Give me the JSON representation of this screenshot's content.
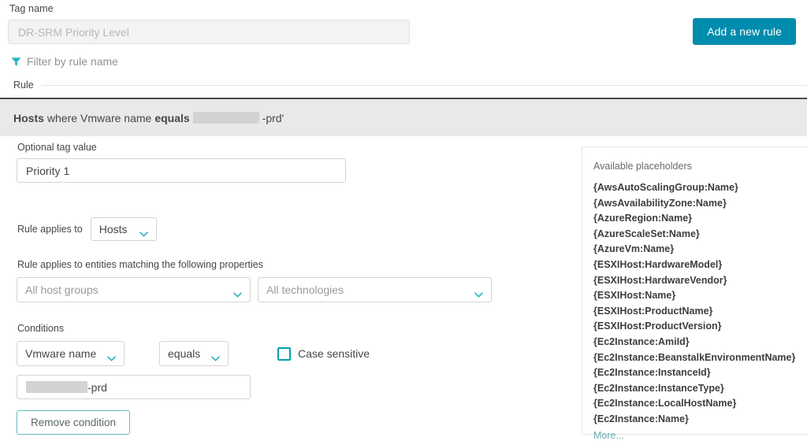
{
  "tag": {
    "label": "Tag name",
    "value_placeholder": "DR-SRM Priority Level"
  },
  "toolbar": {
    "add_rule_label": "Add a new rule"
  },
  "filter": {
    "placeholder": "Filter by rule name",
    "icon": "funnel-icon"
  },
  "rule_list": {
    "column_label": "Rule",
    "summary": {
      "entity": "Hosts",
      "where": "where",
      "attribute": "Vmware name",
      "operator": "equals",
      "redacted_value": "",
      "value_suffix": "-prd'"
    }
  },
  "form": {
    "optional_tag_value_label": "Optional tag value",
    "optional_tag_value": "Priority 1",
    "rule_applies_to_label": "Rule applies to",
    "rule_applies_to_value": "Hosts",
    "properties_label": "Rule applies to entities matching the following properties",
    "host_groups_value": "All host groups",
    "technologies_value": "All technologies",
    "conditions_label": "Conditions",
    "condition": {
      "attribute": "Vmware name",
      "operator": "equals",
      "case_sensitive_label": "Case sensitive",
      "case_sensitive_checked": false,
      "value_suffix": "-prd"
    },
    "remove_condition_label": "Remove condition"
  },
  "placeholders": {
    "title": "Available placeholders",
    "items": [
      "{AwsAutoScalingGroup:Name}",
      "{AwsAvailabilityZone:Name}",
      "{AzureRegion:Name}",
      "{AzureScaleSet:Name}",
      "{AzureVm:Name}",
      "{ESXIHost:HardwareModel}",
      "{ESXIHost:HardwareVendor}",
      "{ESXIHost:Name}",
      "{ESXIHost:ProductName}",
      "{ESXIHost:ProductVersion}",
      "{Ec2Instance:AmiId}",
      "{Ec2Instance:BeanstalkEnvironmentName}",
      "{Ec2Instance:InstanceId}",
      "{Ec2Instance:InstanceType}",
      "{Ec2Instance:LocalHostName}",
      "{Ec2Instance:Name}"
    ],
    "more_label": "More..."
  },
  "colors": {
    "accent_teal": "#008cad",
    "checkbox_teal": "#00a1b2",
    "link_teal": "#6daab5",
    "rule_bar_bg": "#e9e9e9"
  }
}
